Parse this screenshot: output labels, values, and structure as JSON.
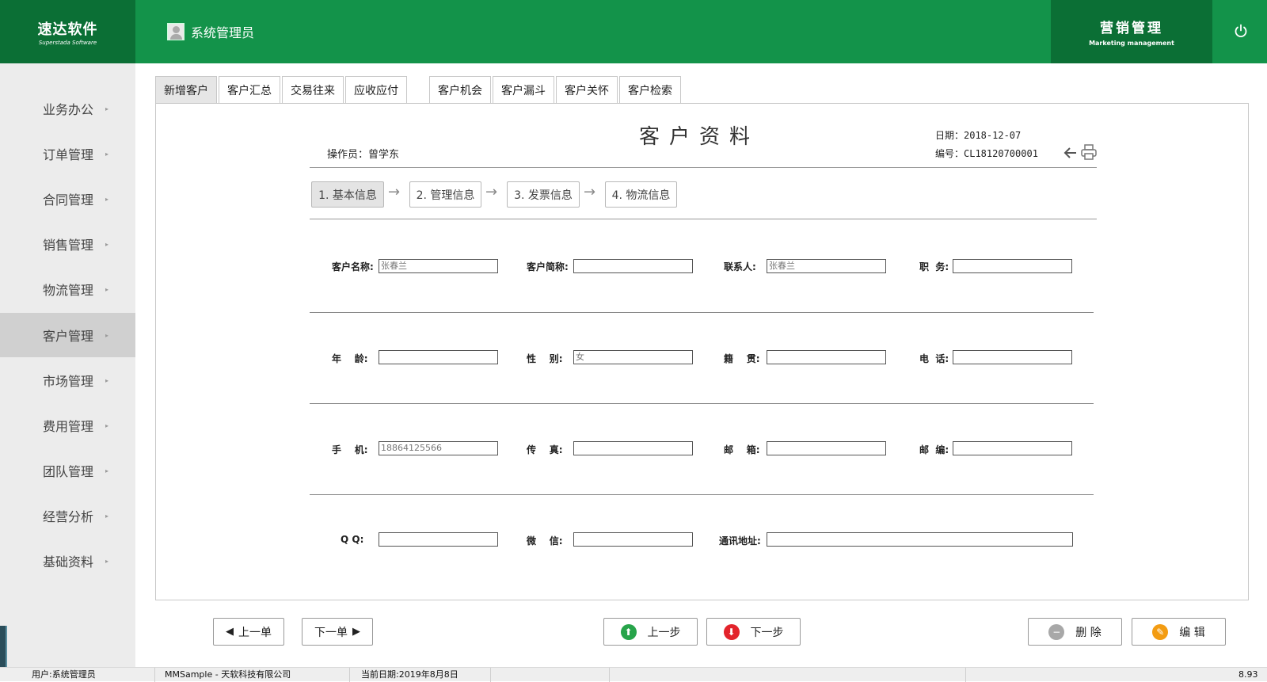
{
  "header": {
    "logo_cn": "速达软件",
    "logo_en": "Superstada Software",
    "user": "系统管理员",
    "module_cn": "营销管理",
    "module_en": "Marketing management"
  },
  "sidebar": {
    "items": [
      {
        "label": "业务办公"
      },
      {
        "label": "订单管理"
      },
      {
        "label": "合同管理"
      },
      {
        "label": "销售管理"
      },
      {
        "label": "物流管理"
      },
      {
        "label": "客户管理"
      },
      {
        "label": "市场管理"
      },
      {
        "label": "费用管理"
      },
      {
        "label": "团队管理"
      },
      {
        "label": "经营分析"
      },
      {
        "label": "基础资料"
      }
    ],
    "active": "客户管理",
    "arrow_glyph": "▸"
  },
  "tabs": [
    {
      "label": "新增客户"
    },
    {
      "label": "客户汇总"
    },
    {
      "label": "交易往来"
    },
    {
      "label": "应收应付"
    },
    {
      "label": "客户机会"
    },
    {
      "label": "客户漏斗"
    },
    {
      "label": "客户关怀"
    },
    {
      "label": "客户检索"
    }
  ],
  "form": {
    "title": "客户资料",
    "operator": "操作员：曾学东",
    "date": "日期：2018-12-07",
    "code": "编号：CL18120700001",
    "steps": [
      {
        "label": "1. 基本信息"
      },
      {
        "label": "2. 管理信息"
      },
      {
        "label": "3. 发票信息"
      },
      {
        "label": "4. 物流信息"
      }
    ],
    "step_arrow": "→",
    "fields": {
      "customer_name": {
        "label": "客户名称:",
        "value": "张春兰"
      },
      "short_name": {
        "label": "客户简称:",
        "value": ""
      },
      "contact": {
        "label": "联系人:",
        "value": "张春兰"
      },
      "position": {
        "label": "职  务:",
        "value": ""
      },
      "age": {
        "label": "年    龄:",
        "value": ""
      },
      "gender": {
        "label": "性    别:",
        "value": "女"
      },
      "native_place": {
        "label": "籍    贯:",
        "value": ""
      },
      "phone": {
        "label": "电  话:",
        "value": ""
      },
      "mobile": {
        "label": "手    机:",
        "value": "18864125566"
      },
      "fax": {
        "label": "传    真:",
        "value": ""
      },
      "mail": {
        "label": "邮    箱:",
        "value": ""
      },
      "zip": {
        "label": "邮  编:",
        "value": ""
      },
      "qq": {
        "label": "Q Q:",
        "value": ""
      },
      "wechat": {
        "label": "微    信:",
        "value": ""
      },
      "address": {
        "label": "通讯地址:",
        "value": ""
      }
    }
  },
  "buttons": {
    "prev_order": "上一单",
    "next_order": "下一单",
    "prev_step": "上一步",
    "next_step": "下一步",
    "delete": "删 除",
    "edit": "编 辑"
  },
  "status_bar": {
    "user": "用户:系统管理员",
    "company": "MMSample - 天软科技有限公司",
    "date": "当前日期:2019年8月8日",
    "version": "8.93"
  },
  "colors": {
    "header_green": "#13934a",
    "dark_green": "#0b6f35",
    "up_green": "#27a44a",
    "down_red": "#e3232b",
    "edit_orange": "#f39c12",
    "delete_gray": "#a8a8a8"
  }
}
